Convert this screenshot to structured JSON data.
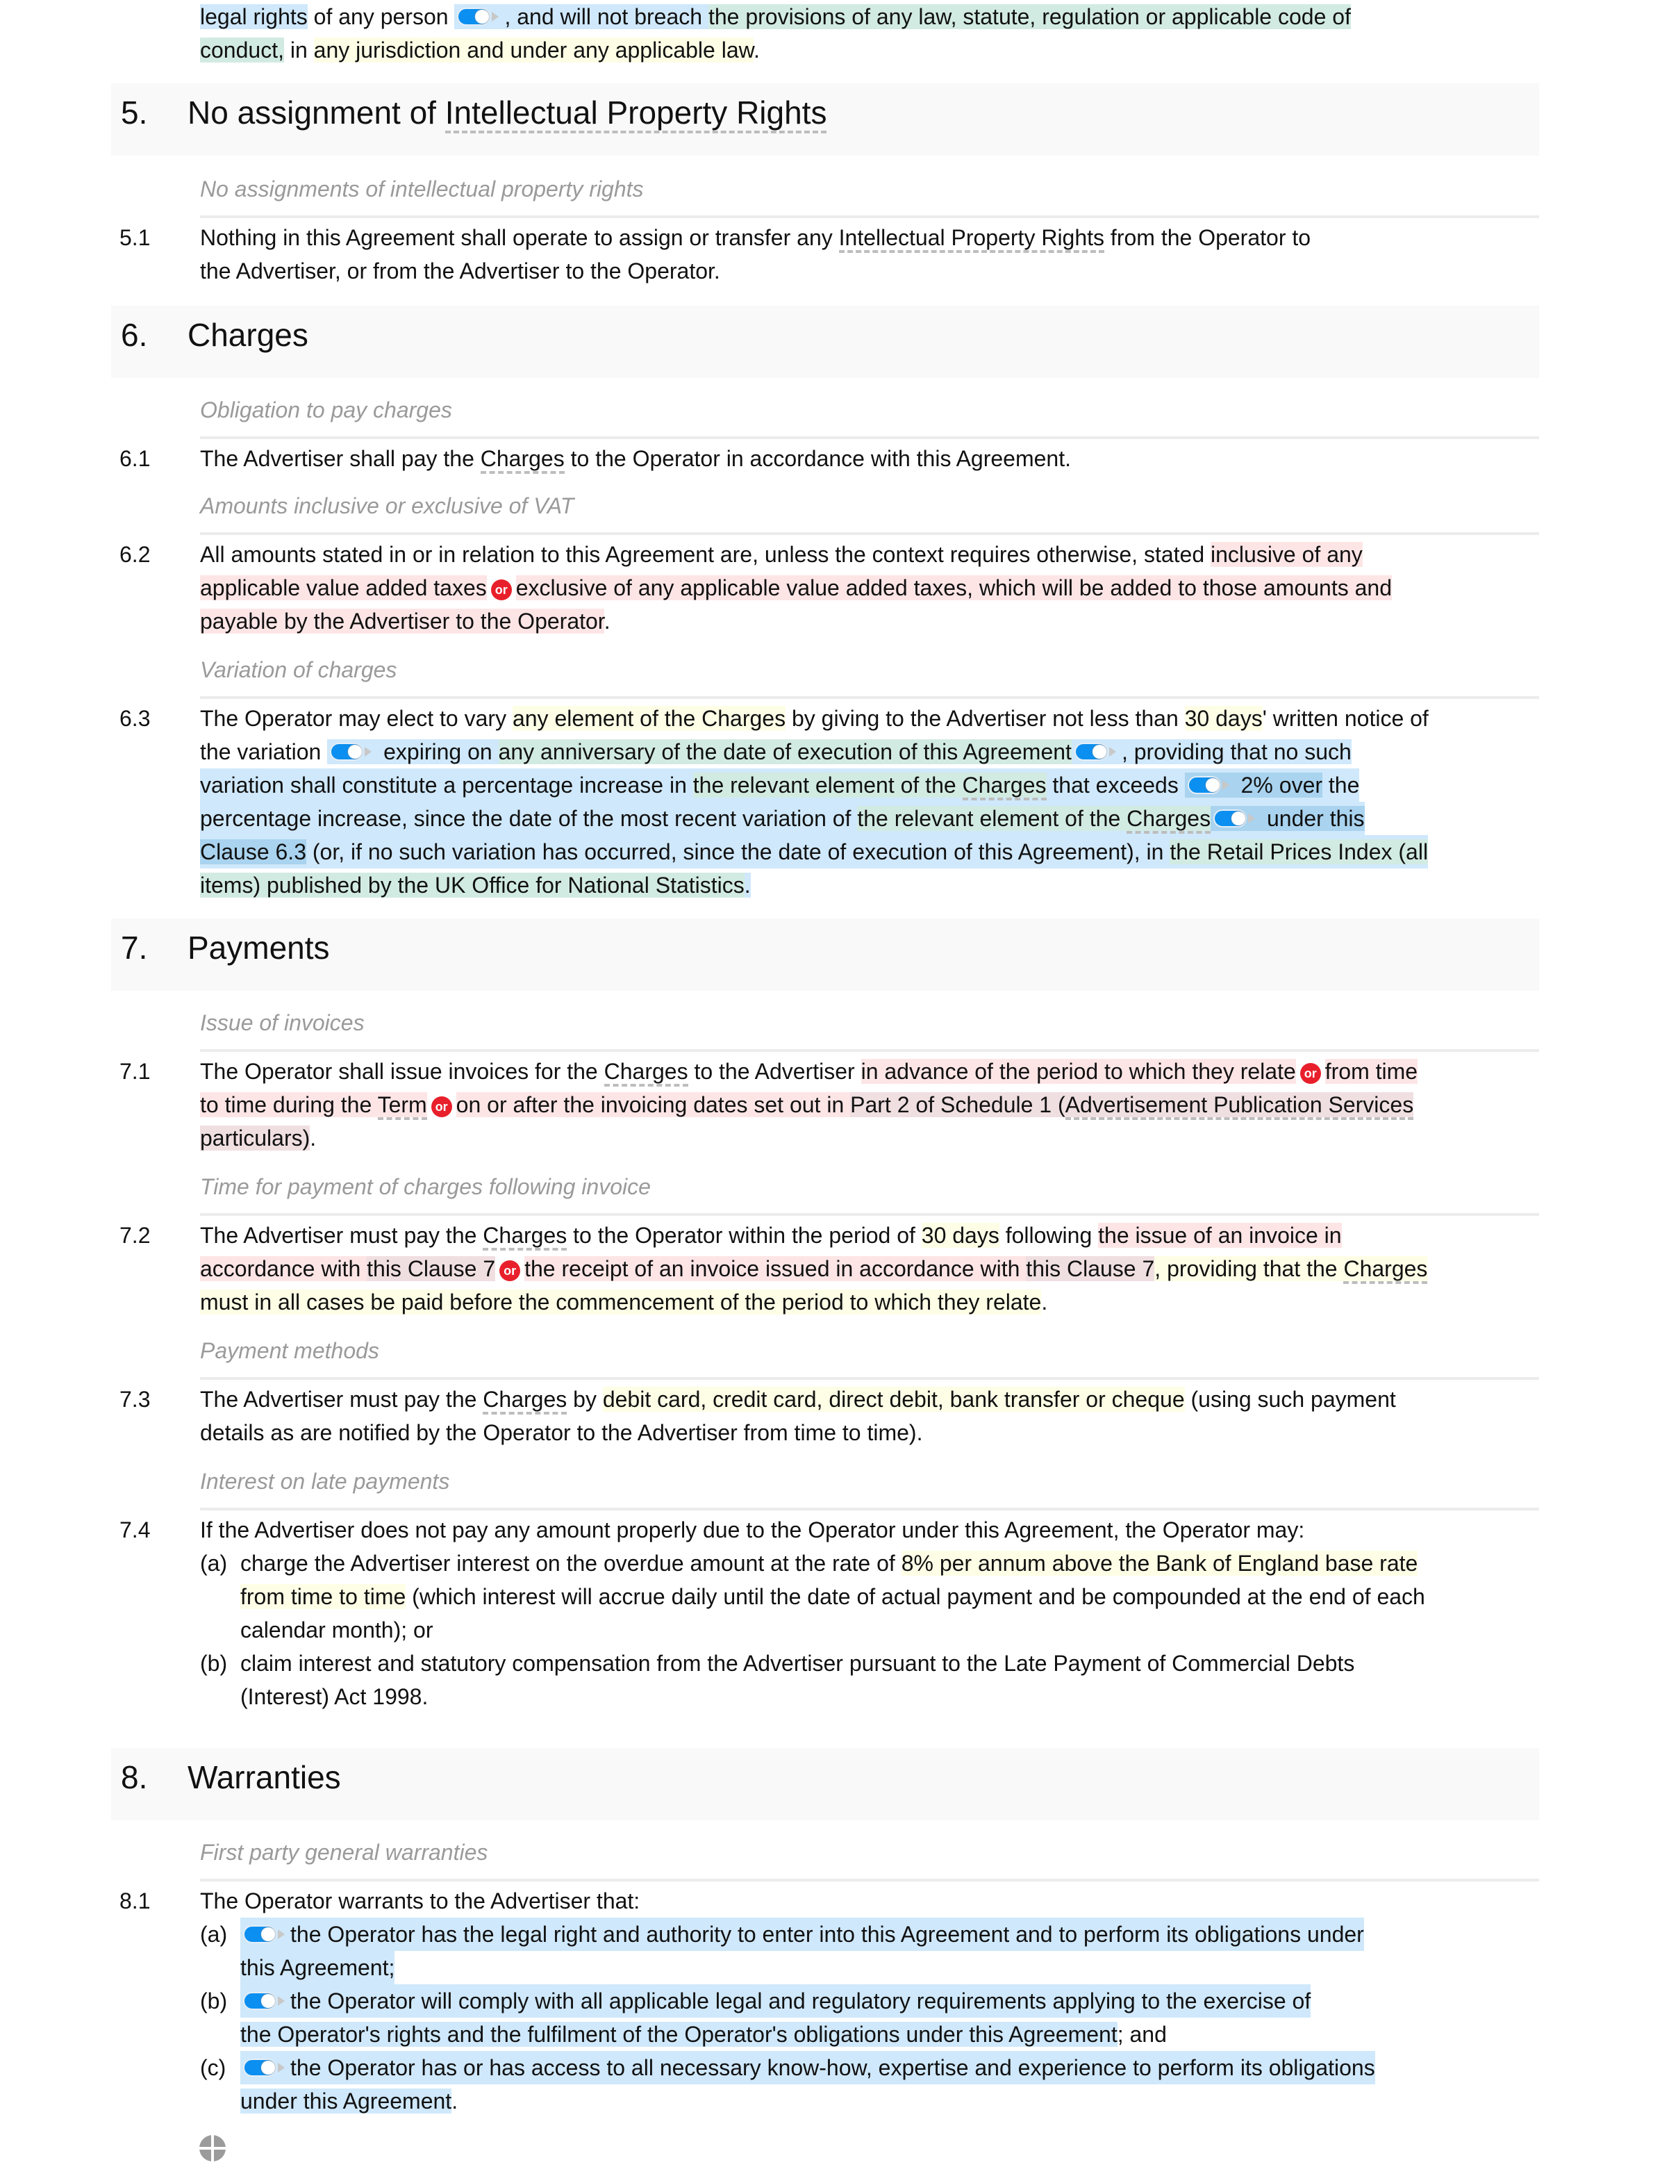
{
  "intro": {
    "line1_a": "legal rights",
    "line1_b": " of any person ",
    "line1_c": ", and will not breach ",
    "line1_d": "the provisions of any law, statute, regulation or applicable code of",
    "line2_a": "conduct,",
    "line2_b": " in ",
    "line2_c": "any jurisdiction and under any applicable law",
    "line2_d": "."
  },
  "sections": {
    "s5": {
      "number": "5.",
      "title_a": "No assignment of ",
      "title_b": "Intellectual Property Rights",
      "subheading": "No assignments of intellectual property rights",
      "c1": {
        "number": "5.1",
        "a": "Nothing in this Agreement shall operate to assign or transfer any ",
        "b": "Intellectual Property Rights",
        "c": " from the Operator to",
        "d": "the Advertiser, or from the Advertiser to the Operator."
      }
    },
    "s6": {
      "number": "6.",
      "title": "Charges",
      "sub1": "Obligation to pay charges",
      "c1": {
        "number": "6.1",
        "a": "The Advertiser shall pay the ",
        "b": "Charges",
        "c": " to the Operator in accordance with this Agreement."
      },
      "sub2": "Amounts inclusive or exclusive of VAT",
      "c2": {
        "number": "6.2",
        "a": "All amounts stated in or in relation to this Agreement are, unless the context requires otherwise, stated ",
        "b": "inclusive of any",
        "c": "applicable value added taxes",
        "or": "or",
        "d": "exclusive of any applicable value added taxes, which will be added to those amounts and",
        "e": "payable by the Advertiser to the Operator",
        "f": "."
      },
      "sub3": "Variation of charges",
      "c3": {
        "number": "6.3",
        "l1_a": "The Operator may elect to vary ",
        "l1_b": "any element of the ",
        "l1_c": "Charges",
        "l1_d": " by giving to the Advertiser not less than ",
        "l1_e": "30 days",
        "l1_f": "' written notice of",
        "l2_a": "the variation ",
        "l2_b": " expiring on ",
        "l2_c": "any anniversary of the date of execution of this Agreement",
        "l2_d": ", providing that no such",
        "l3_a": "variation shall constitute a percentage increase in ",
        "l3_b": "the relevant element of the ",
        "l3_c": "Charges",
        "l3_d": " that exceeds ",
        "l3_e": " 2% over",
        "l3_f": " the",
        "l4_a": "percentage increase, since the date of the most recent variation of ",
        "l4_b": "the relevant element of the ",
        "l4_c": "Charges",
        "l4_d": " under this",
        "l5_a": "Clause 6.3",
        "l5_b": " (or, if no such variation has occurred, since the date of execution of this Agreement), in ",
        "l5_c": "the Retail Prices Index (all",
        "l6_a": "items) published by the UK Office for National Statistics",
        "l6_b": "."
      }
    },
    "s7": {
      "number": "7.",
      "title": "Payments",
      "sub1": "Issue of invoices",
      "c1": {
        "number": "7.1",
        "l1_a": "The Operator shall issue invoices for the ",
        "l1_b": "Charges",
        "l1_c": " to the Advertiser ",
        "l1_d": "in advance of the period to which they relate",
        "or1": "or",
        "l1_e": "from time",
        "l2_a": "to time during the ",
        "l2_b": "Term",
        "or2": "or",
        "l2_c": "on or after the invoicing dates set out in ",
        "l2_d": "Part 2 of Schedule 1 (",
        "l2_e": "Advertisement Publication Services",
        "l3_a": "particulars)",
        "l3_b": "."
      },
      "sub2": "Time for payment of charges following invoice",
      "c2": {
        "number": "7.2",
        "l1_a": "The Advertiser must pay the ",
        "l1_b": "Charges",
        "l1_c": " to the Operator within the period of ",
        "l1_d": "30 days",
        "l1_e": " following ",
        "l1_f": "the issue of an invoice in",
        "l2_a": "accordance with ",
        "l2_b": "this Clause 7",
        "or": "or",
        "l2_c": "the receipt of an invoice issued in accordance with ",
        "l2_d": "this Clause 7",
        "l2_e": ", providing that the ",
        "l2_f": "Charges",
        "l3_a": "must in all cases be paid before the commencement of the period to which they relate",
        "l3_b": "."
      },
      "sub3": "Payment methods",
      "c3": {
        "number": "7.3",
        "l1_a": "The Advertiser must pay the ",
        "l1_b": "Charges",
        "l1_c": " by ",
        "l1_d": "debit card, credit card, direct debit, bank transfer or cheque",
        "l1_e": " (using such payment",
        "l2": "details as are notified by the Operator to the Advertiser from time to time)."
      },
      "sub4": "Interest on late payments",
      "c4": {
        "number": "7.4",
        "intro": "If the Advertiser does not pay any amount properly due to the Operator under this Agreement, the Operator may:",
        "a_label": "(a)",
        "a_l1_a": "charge the Advertiser interest on the overdue amount at the rate of ",
        "a_l1_b": "8% per annum above the Bank of England base rate",
        "a_l2_a": "from time to time",
        "a_l2_b": " (which interest will accrue daily until the date of actual payment and be compounded at the end of each",
        "a_l3": "calendar month); or",
        "b_label": "(b)",
        "b_l1": "claim interest and statutory compensation from the Advertiser pursuant to the Late Payment of Commercial Debts",
        "b_l2": "(Interest) Act 1998."
      }
    },
    "s8": {
      "number": "8.",
      "title": "Warranties",
      "sub1": "First party general warranties",
      "c1": {
        "number": "8.1",
        "intro": "The Operator warrants to the Advertiser that:",
        "a_label": "(a)",
        "a_l1": "the Operator has the legal right and authority to enter into this Agreement and to perform its obligations under",
        "a_l2": "this Agreement;",
        "b_label": "(b)",
        "b_l1": "the Operator will comply with all applicable legal and regulatory requirements applying to the exercise of",
        "b_l2_a": "the Operator's rights and the fulfilment of the Operator's obligations under this Agreement",
        "b_l2_b": "; and",
        "c_label": "(c)",
        "c_l1": "the Operator has or has access to all necessary know-how, expertise and experience to perform its obligations",
        "c_l2_a": "under this Agreement",
        "c_l2_b": "."
      }
    }
  },
  "icons": {
    "toggle": "toggle-switch-icon",
    "or_badge": "or-badge",
    "move": "move-handle-icon"
  },
  "colors": {
    "highlight_blue": "#cfe8fb",
    "highlight_green": "#d2ebe2",
    "highlight_yellow": "#fefee6",
    "highlight_red": "#fde5e6",
    "toggle_blue": "#0b8ff0",
    "or_red": "#e8202b",
    "subheading_gray": "#9a9a9a",
    "heading_band": "#f9f9f9"
  }
}
